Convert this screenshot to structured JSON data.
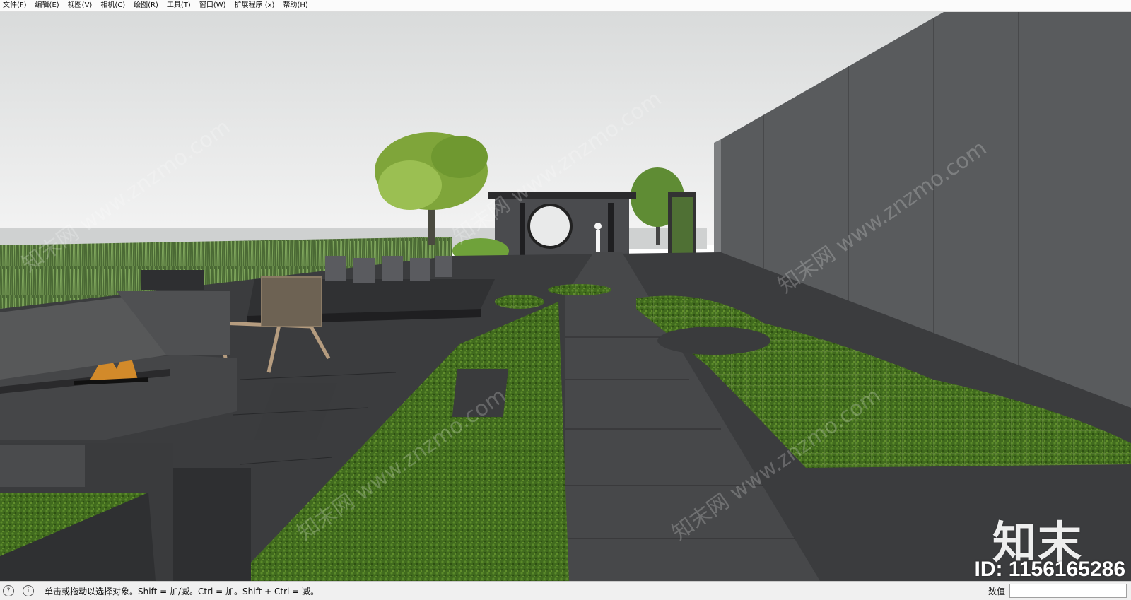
{
  "menu": [
    {
      "label": "文件(F)"
    },
    {
      "label": "编辑(E)"
    },
    {
      "label": "视图(V)"
    },
    {
      "label": "相机(C)"
    },
    {
      "label": "绘图(R)"
    },
    {
      "label": "工具(T)"
    },
    {
      "label": "窗口(W)"
    },
    {
      "label": "扩展程序 (x)"
    },
    {
      "label": "帮助(H)"
    }
  ],
  "viewport": {
    "watermark_logo": "知末",
    "watermark_id": "ID: 1156165286",
    "watermark_diagonal": "知末网 www.znzmo.com"
  },
  "status": {
    "hint": "单击或拖动以选择对象。Shift = 加/减。Ctrl = 加。Shift + Ctrl = 减。",
    "measure_label": "数值",
    "measure_value": ""
  },
  "colors": {
    "sky": "#e9eaea",
    "wall": "#5a5c5e",
    "paving": "#3c3d3f",
    "grass": "#3f6a1c",
    "tree": "#7fa53a"
  }
}
